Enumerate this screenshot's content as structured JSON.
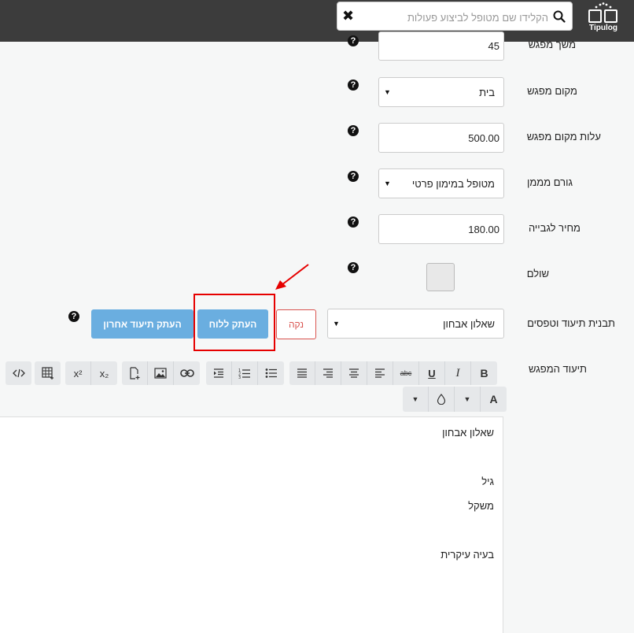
{
  "topbar": {
    "logo_text": "Tipulog",
    "search_placeholder": "הקלידו שם מטופל לביצוע פעולות",
    "clear_symbol": "✖"
  },
  "form": {
    "rows": [
      {
        "label": "משך מפגש",
        "value": "45"
      },
      {
        "label": "מקום מפגש",
        "value": "בית"
      },
      {
        "label": "עלות מקום מפגש",
        "value": "500.00"
      },
      {
        "label": "גורם מממן",
        "value": "מטופל במימון פרטי"
      },
      {
        "label": "מחיר לגבייה",
        "value": "180.00"
      },
      {
        "label": "שולם",
        "value": ""
      }
    ],
    "template_label": "תבנית תיעוד וטפסים",
    "template_value": "שאלון אבחון",
    "clear_button": "נקה",
    "copy_to_board_button": "העתק ללוח",
    "copy_last_button": "העתק תיעוד אחרון",
    "documentation_label": "תיעוד המפגש",
    "help_symbol": "?"
  },
  "toolbar": {
    "bold": "B",
    "italic": "I",
    "underline": "U",
    "strike": "abc",
    "font_color": "A",
    "superscript": "x²",
    "subscript": "x₂"
  },
  "editor": {
    "lines": [
      "שאלון אבחון",
      "גיל",
      "משקל",
      "בעיה עיקרית"
    ]
  },
  "colors": {
    "topbar": "#3c3c3c",
    "primary_button": "#6aaee0",
    "danger": "#d9534f",
    "annotation": "#e60000"
  }
}
